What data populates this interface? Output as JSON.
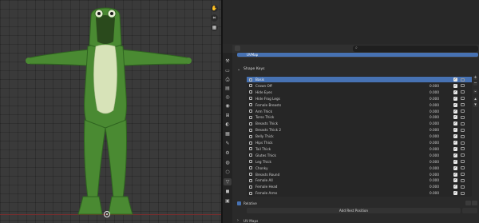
{
  "viewport": {
    "tool_icons": [
      "hand-icon",
      "camera-icon",
      "grid-icon"
    ],
    "tool_glyphs": [
      "✋",
      "⌗",
      "▦"
    ],
    "ground_line_color": "#7a2d2d",
    "character": {
      "body_color": "#4a8a32",
      "body_dark": "#2f6420",
      "belly_color": "#d7e3b8",
      "eye_color": "#e9f0d6",
      "pupil_color": "#1a1a1a"
    }
  },
  "properties": {
    "search": {
      "placeholder": ""
    },
    "uv_map": {
      "selected": "UVMap"
    },
    "tab_glyphs": [
      "⚒",
      "▭",
      "⎙",
      "▤",
      "◎",
      "◉",
      "⊞",
      "◐",
      "▦",
      "✎",
      "⚙",
      "◍",
      "⬡",
      "▽",
      "◼",
      "▣"
    ],
    "shape_keys": {
      "title": "Shape Keys",
      "items": [
        {
          "name": "Basis",
          "value": "",
          "selected": true
        },
        {
          "name": "Crown Off",
          "value": "0.000",
          "selected": false
        },
        {
          "name": "Hide Eyes",
          "value": "0.000",
          "selected": false
        },
        {
          "name": "Hide Frog Legs",
          "value": "0.000",
          "selected": false
        },
        {
          "name": "Female Breasts",
          "value": "0.000",
          "selected": false
        },
        {
          "name": "Arm Thick",
          "value": "0.000",
          "selected": false
        },
        {
          "name": "Torso Thick",
          "value": "0.000",
          "selected": false
        },
        {
          "name": "Breasts Thick",
          "value": "0.000",
          "selected": false
        },
        {
          "name": "Breasts Thick 2",
          "value": "0.000",
          "selected": false
        },
        {
          "name": "Belly Thick",
          "value": "0.000",
          "selected": false
        },
        {
          "name": "Hips Thick",
          "value": "0.000",
          "selected": false
        },
        {
          "name": "Tail Thick",
          "value": "0.000",
          "selected": false
        },
        {
          "name": "Glutes Thick",
          "value": "0.000",
          "selected": false
        },
        {
          "name": "Leg Thick",
          "value": "0.000",
          "selected": false
        },
        {
          "name": "Chonky",
          "value": "0.000",
          "selected": false
        },
        {
          "name": "Breasts Round",
          "value": "0.000",
          "selected": false
        },
        {
          "name": "Female All",
          "value": "0.000",
          "selected": false
        },
        {
          "name": "Female Head",
          "value": "0.000",
          "selected": false
        },
        {
          "name": "Female Arms",
          "value": "0.000",
          "selected": false
        }
      ],
      "relative_label": "Relative",
      "add_rest_label": "Add Rest Position"
    },
    "uv_maps": {
      "title": "UV Maps"
    },
    "accent_color": "#4772b3"
  }
}
